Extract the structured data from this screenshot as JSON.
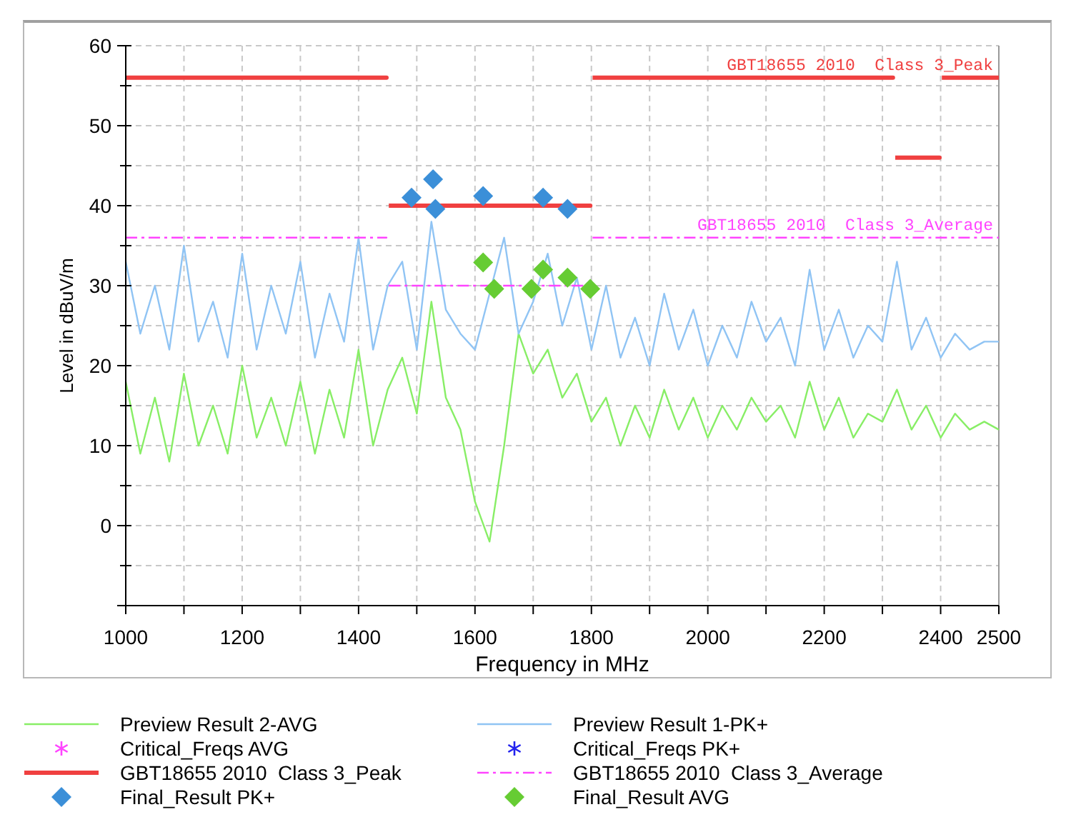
{
  "chart_data": {
    "type": "line",
    "xlabel": "Frequency in MHz",
    "ylabel": "Level in dBuV/m",
    "xlim": [
      1000,
      2500
    ],
    "ylim": [
      -10,
      60
    ],
    "xticks": [
      1000,
      1200,
      1400,
      1600,
      1800,
      2000,
      2200,
      2400,
      2500
    ],
    "yticks": [
      0,
      10,
      20,
      30,
      40,
      50,
      60
    ],
    "grid": true,
    "series": [
      {
        "name": "Preview Result 2-AVG",
        "type": "line",
        "color": "#88ee66",
        "line_style": "solid",
        "x": [
          1000,
          1025,
          1050,
          1075,
          1100,
          1125,
          1150,
          1175,
          1200,
          1225,
          1250,
          1275,
          1300,
          1325,
          1350,
          1375,
          1400,
          1425,
          1450,
          1475,
          1500,
          1525,
          1550,
          1575,
          1600,
          1625,
          1650,
          1675,
          1700,
          1725,
          1750,
          1775,
          1800,
          1825,
          1850,
          1875,
          1900,
          1925,
          1950,
          1975,
          2000,
          2025,
          2050,
          2075,
          2100,
          2125,
          2150,
          2175,
          2200,
          2225,
          2250,
          2275,
          2300,
          2325,
          2350,
          2375,
          2400,
          2425,
          2450,
          2475,
          2500
        ],
        "values": [
          18,
          9,
          16,
          8,
          19,
          10,
          15,
          9,
          20,
          11,
          16,
          10,
          18,
          9,
          17,
          11,
          22,
          10,
          17,
          21,
          14,
          28,
          16,
          12,
          3,
          -2,
          10,
          24,
          19,
          22,
          16,
          19,
          13,
          16,
          10,
          15,
          11,
          17,
          12,
          16,
          11,
          15,
          12,
          16,
          13,
          15,
          11,
          18,
          12,
          16,
          11,
          14,
          13,
          17,
          12,
          15,
          11,
          14,
          12,
          13,
          12
        ]
      },
      {
        "name": "Preview Result 1-PK+",
        "type": "line",
        "color": "#90c4f4",
        "line_style": "solid",
        "x": [
          1000,
          1025,
          1050,
          1075,
          1100,
          1125,
          1150,
          1175,
          1200,
          1225,
          1250,
          1275,
          1300,
          1325,
          1350,
          1375,
          1400,
          1425,
          1450,
          1475,
          1500,
          1525,
          1550,
          1575,
          1600,
          1625,
          1650,
          1675,
          1700,
          1725,
          1750,
          1775,
          1800,
          1825,
          1850,
          1875,
          1900,
          1925,
          1950,
          1975,
          2000,
          2025,
          2050,
          2075,
          2100,
          2125,
          2150,
          2175,
          2200,
          2225,
          2250,
          2275,
          2300,
          2325,
          2350,
          2375,
          2400,
          2425,
          2450,
          2475,
          2500
        ],
        "values": [
          33,
          24,
          30,
          22,
          35,
          23,
          28,
          21,
          34,
          22,
          30,
          24,
          33,
          21,
          29,
          23,
          36,
          22,
          30,
          33,
          22,
          38,
          27,
          24,
          22,
          29,
          36,
          24,
          28,
          34,
          25,
          31,
          22,
          30,
          21,
          26,
          20,
          29,
          22,
          27,
          20,
          25,
          21,
          28,
          23,
          26,
          20,
          32,
          22,
          27,
          21,
          25,
          23,
          33,
          22,
          26,
          21,
          24,
          22,
          23,
          23
        ]
      },
      {
        "name": "Critical_Freqs AVG",
        "type": "scatter",
        "color": "#ff44ff",
        "marker": "asterisk"
      },
      {
        "name": "Critical_Freqs PK+",
        "type": "scatter",
        "color": "#2222ee",
        "marker": "asterisk"
      },
      {
        "name": "GBT18655 2010  Class 3_Peak",
        "type": "line",
        "color": "#f04040",
        "line_style": "solid",
        "x": [
          1000,
          1448,
          1450,
          1452,
          1798,
          1800,
          1802,
          2318,
          2320,
          2322,
          2398,
          2400,
          2402,
          2500
        ],
        "values": [
          56,
          56,
          null,
          40,
          40,
          null,
          56,
          56,
          null,
          46,
          46,
          null,
          56,
          56
        ]
      },
      {
        "name": "GBT18655 2010  Class 3_Average",
        "type": "line",
        "color": "#ff44ff",
        "line_style": "dashdot",
        "x": [
          1000,
          1448,
          1450,
          1452,
          1798,
          1800,
          1802,
          2500
        ],
        "values": [
          36,
          36,
          null,
          30,
          30,
          null,
          36,
          36
        ]
      },
      {
        "name": "Final_Result PK+",
        "type": "scatter",
        "color": "#3b8fd8",
        "marker": "diamond",
        "x": [
          1491,
          1528,
          1532,
          1614,
          1717,
          1759
        ],
        "values": [
          41,
          43.3,
          39.6,
          41.2,
          41,
          39.6
        ]
      },
      {
        "name": "Final_Result AVG",
        "type": "scatter",
        "color": "#66cc33",
        "marker": "diamond",
        "x": [
          1614,
          1633,
          1697,
          1717,
          1759,
          1798
        ],
        "values": [
          32.9,
          29.6,
          29.6,
          32,
          31,
          29.6
        ]
      }
    ]
  },
  "limit_labels": [
    "GBT18655 2010  Class 3_Peak",
    "GBT18655 2010  Class 3_Average"
  ]
}
